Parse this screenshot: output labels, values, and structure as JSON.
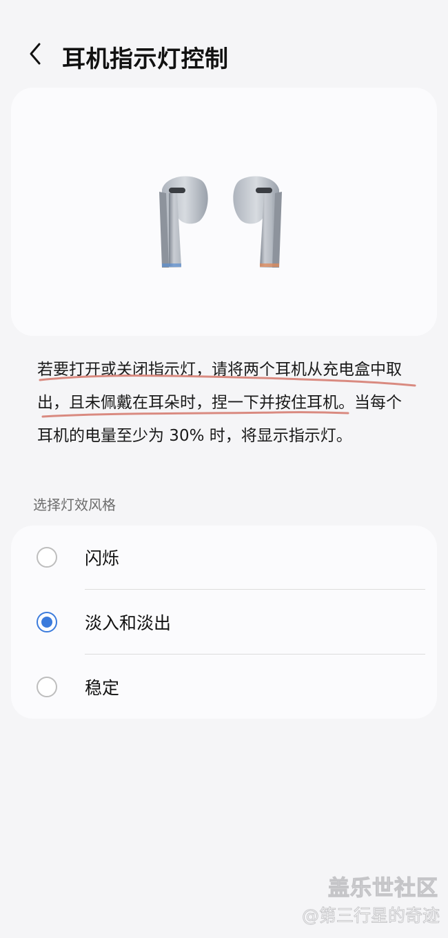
{
  "header": {
    "title": "耳机指示灯控制"
  },
  "description": {
    "line1": "若要打开或关闭指示灯，请将两个耳机从充电盒中取",
    "line2": "出，且未佩戴在耳朵时，捏一下并按住耳机。当每个",
    "line3": "耳机的电量至少为 30% 时，将显示指示灯。"
  },
  "section": {
    "title": "选择灯效风格"
  },
  "options": [
    {
      "label": "闪烁",
      "selected": false
    },
    {
      "label": "淡入和淡出",
      "selected": true
    },
    {
      "label": "稳定",
      "selected": false
    }
  ],
  "watermark": {
    "brand": "盖乐世社区",
    "handle": "@第三行星的奇迹"
  },
  "colors": {
    "accent": "#3b7bdc",
    "scribble": "#d98a80"
  },
  "icons": {
    "back": "chevron-left-icon",
    "earbuds": "earbuds-illustration"
  }
}
